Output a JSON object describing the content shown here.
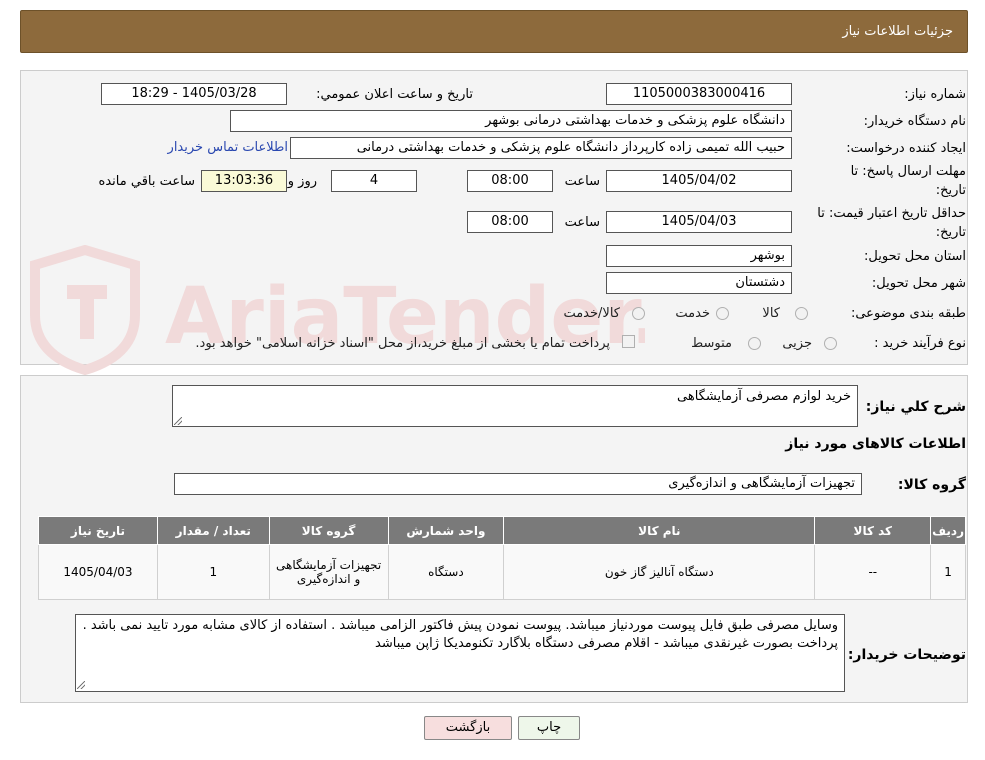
{
  "header": {
    "title": "جزئیات اطلاعات نیاز"
  },
  "form": {
    "need_number_label": "شماره نیاز:",
    "need_number": "1105000383000416",
    "announce_label": "تاریخ و ساعت اعلان عمومي:",
    "announce_value": "1405/03/28 - 18:29",
    "buyer_org_label": "نام دستگاه خريدار:",
    "buyer_org": "دانشگاه علوم پزشکی و خدمات بهداشتی درمانی بوشهر",
    "requester_label": "ايجاد کننده درخواست:",
    "requester": "حبیب الله تمیمی زاده کارپرداز دانشگاه علوم پزشکی و خدمات بهداشتی درمانی",
    "contact_link": "اطلاعات تماس خريدار",
    "reply_deadline_label_1": "مهلت ارسال پاسخ: تا",
    "reply_deadline_label_2": "تاریخ:",
    "reply_date": "1405/04/02",
    "time_label": "ساعت",
    "reply_time": "08:00",
    "days_value": "4",
    "days_label": "روز و",
    "remaining_time": "13:03:36",
    "remaining_label": "ساعت باقي مانده",
    "price_validity_label_1": "حداقل تاریخ اعتبار قیمت: تا",
    "price_validity_label_2": "تاریخ:",
    "price_date": "1405/04/03",
    "price_time": "08:00",
    "province_label": "استان محل تحویل:",
    "province": "بوشهر",
    "city_label": "شهر محل تحویل:",
    "city": "دشتستان",
    "category_label": "طبقه بندی موضوعی:",
    "category_options": [
      "کالا",
      "خدمت",
      "کالا/خدمت"
    ],
    "process_label": "نوع فرآیند خرید :",
    "process_options": [
      "جزیی",
      "متوسط"
    ],
    "treasury_note": "پرداخت تمام یا بخشی از مبلغ خرید،از محل \"اسناد خزانه اسلامی\" خواهد بود."
  },
  "description": {
    "label": "شرح کلي نياز:",
    "value": "خرید لوازم مصرفی آزمایشگاهی"
  },
  "goods": {
    "section_title": "اطلاعات کالاهای مورد نياز",
    "group_label": "گروه کالا:",
    "group_value": "تجهیزات آزمایشگاهی و اندازه‌گیری"
  },
  "table": {
    "headers": [
      "رديف",
      "کد کالا",
      "نام کالا",
      "واحد شمارش",
      "گروه کالا",
      "تعداد / مقدار",
      "تاريخ نياز"
    ],
    "rows": [
      [
        "1",
        "--",
        "دستگاه آنالیز گاز خون",
        "دستگاه",
        "تجهیزات آزمایشگاهی و اندازه‌گیری",
        "1",
        "1405/04/03"
      ]
    ]
  },
  "buyer_notes": {
    "label": "توضیحات خریدار:",
    "value": "وسایل مصرفی طبق فایل پیوست موردنیاز میباشد. پیوست نمودن پیش فاکتور الزامی میباشد . استفاده از کالای مشابه مورد تایید نمی باشد . پرداخت بصورت غیرنقدی میباشد - اقلام مصرفی دستگاه بلاگارد تکنومدیکا ژاپن میباشد"
  },
  "buttons": {
    "print": "چاپ",
    "back": "بازگشت"
  },
  "colors": {
    "header": "#8d6a3c",
    "link": "#2a48b0",
    "watermark": "#f1dada"
  }
}
